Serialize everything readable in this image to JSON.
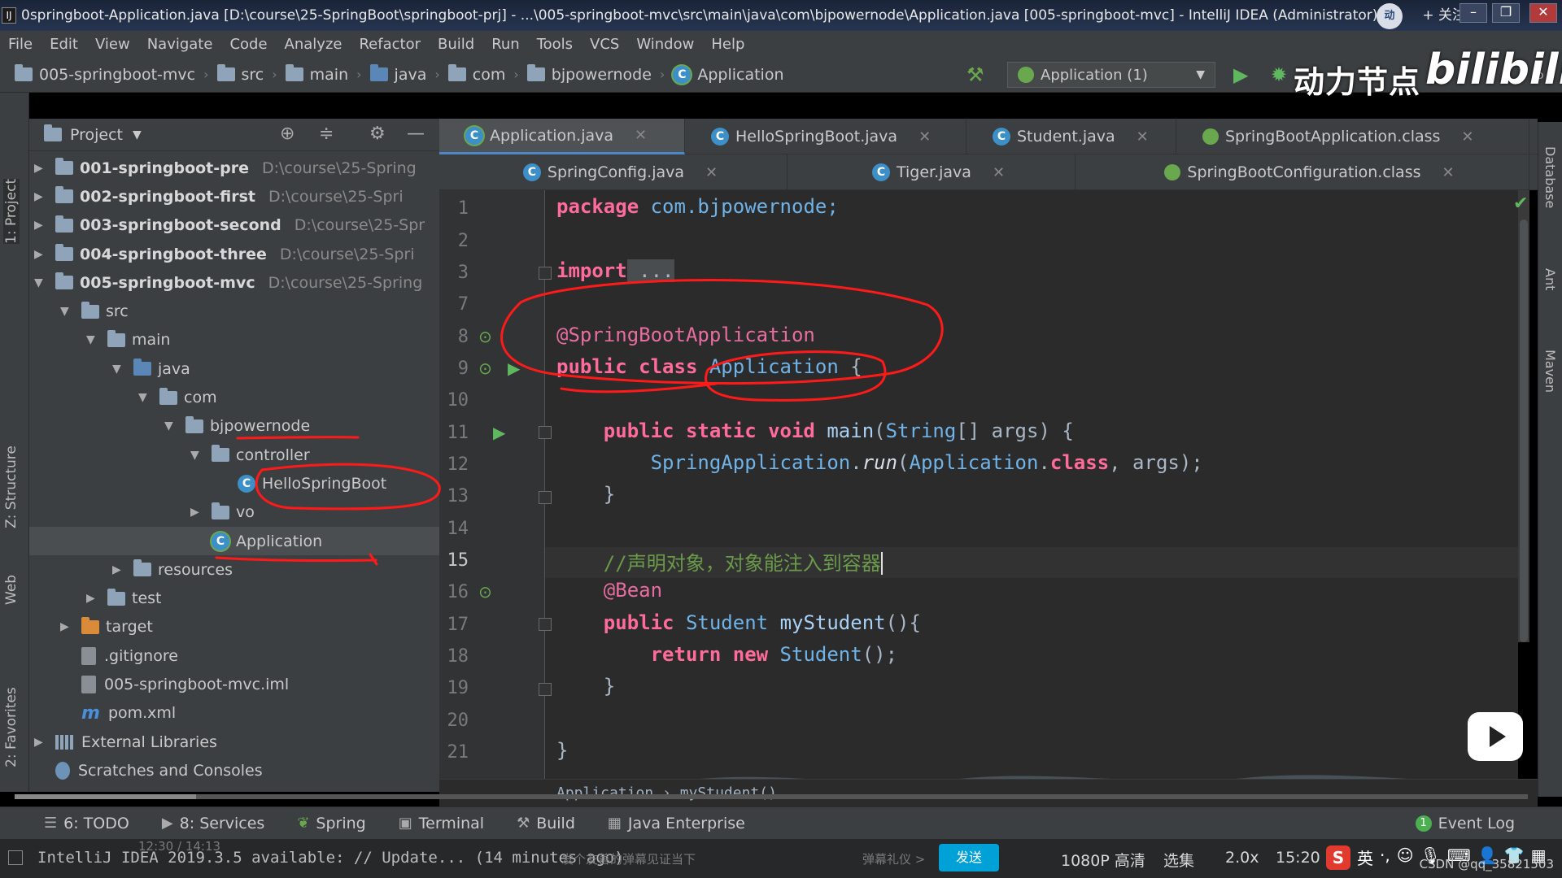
{
  "window": {
    "title": "0springboot-Application.java [D:\\course\\25-SpringBoot\\springboot-prj] - ...\\005-springboot-mvc\\src\\main\\java\\com\\bjpowernode\\Application.java [005-springboot-mvc] - IntelliJ IDEA (Administrator)",
    "follow_label": "+ 关注"
  },
  "menu": [
    "File",
    "Edit",
    "View",
    "Navigate",
    "Code",
    "Analyze",
    "Refactor",
    "Build",
    "Run",
    "Tools",
    "VCS",
    "Window",
    "Help"
  ],
  "nav": {
    "crumbs": [
      "005-springboot-mvc",
      "src",
      "main",
      "java",
      "com",
      "bjpowernode",
      "Application"
    ],
    "run_config": "Application (1)"
  },
  "overlay": {
    "brand": "动力节点",
    "site": "bilibili"
  },
  "left_tabs": {
    "project": "1: Project",
    "structure": "Z: Structure",
    "web": "Web",
    "favorites": "2: Favorites"
  },
  "right_tabs": {
    "database": "Database",
    "ant": "Ant",
    "maven": "Maven"
  },
  "project": {
    "title": "Project",
    "tree": [
      {
        "label": "001-springboot-pre",
        "path": "D:\\course\\25-Spring"
      },
      {
        "label": "002-springboot-first",
        "path": "D:\\course\\25-Spri"
      },
      {
        "label": "003-springboot-second",
        "path": "D:\\course\\25-Spr"
      },
      {
        "label": "004-springboot-three",
        "path": "D:\\course\\25-Spri"
      },
      {
        "label": "005-springboot-mvc",
        "path": "D:\\course\\25-Spring"
      },
      {
        "label": "src"
      },
      {
        "label": "main"
      },
      {
        "label": "java"
      },
      {
        "label": "com"
      },
      {
        "label": "bjpowernode"
      },
      {
        "label": "controller"
      },
      {
        "label": "HelloSpringBoot"
      },
      {
        "label": "vo"
      },
      {
        "label": "Application"
      },
      {
        "label": "resources"
      },
      {
        "label": "test"
      },
      {
        "label": "target"
      },
      {
        "label": ".gitignore"
      },
      {
        "label": "005-springboot-mvc.iml"
      },
      {
        "label": "pom.xml"
      },
      {
        "label": "External Libraries"
      },
      {
        "label": "Scratches and Consoles"
      }
    ]
  },
  "tabs_row1": [
    "Application.java",
    "HelloSpringBoot.java",
    "Student.java",
    "SpringBootApplication.class"
  ],
  "tabs_row2": [
    "SpringConfig.java",
    "Tiger.java",
    "SpringBootConfiguration.class"
  ],
  "editor": {
    "line_numbers": [
      "1",
      "2",
      "3",
      "7",
      "8",
      "9",
      "10",
      "11",
      "12",
      "13",
      "14",
      "15",
      "16",
      "17",
      "18",
      "19",
      "20",
      "21"
    ],
    "code": {
      "l1_kw": "package",
      "l1_rest": " com.bjpowernode;",
      "l3_kw": "import",
      "l3_rest": " ...",
      "l8": "@SpringBootApplication",
      "l9_kw": "public class",
      "l9_ty": "Application",
      "l9_rest": " {",
      "l11_kw": "public static void",
      "l11_fn": "main",
      "l11_a": "(",
      "l11_ty": "String",
      "l11_b": "[] args) {",
      "l12_ty": "SpringApplication",
      "l12_dot": ".",
      "l12_it": "run",
      "l12_a": "(",
      "l12_ty2": "Application",
      "l12_dot2": ".",
      "l12_kw": "class",
      "l12_b": ", args);",
      "l13": "}",
      "l15": "//声明对象，对象能注入到容器",
      "l16": "@Bean",
      "l17_kw": "public",
      "l17_ty": "Student",
      "l17_fn": "myStudent",
      "l17_rest": "(){",
      "l18_kw": "return new",
      "l18_ty": "Student",
      "l18_rest": "();",
      "l19": "}",
      "l21": "}"
    },
    "breadcrumb": "Application  ›  myStudent()"
  },
  "toolstrip": {
    "items": [
      "6: TODO",
      "8: Services",
      "Spring",
      "Terminal",
      "Build",
      "Java Enterprise"
    ],
    "event_log": "Event Log",
    "event_count": "1"
  },
  "status": {
    "message": "IntelliJ IDEA 2019.3.5 available: // Update... (14 minutes ago)",
    "player_time": "12:30 / 14:13",
    "danmaku_placeholder": "发个友善的弹幕见证当下",
    "danmaku_gift": "弹幕礼仪 >",
    "send": "发送",
    "quality": "1080P 高清",
    "episodes": "选集",
    "speed": "2.0x",
    "clock": "15:20",
    "ime": "S",
    "ime_lang": "英",
    "watermark": "CSDN @qq_35821503"
  }
}
